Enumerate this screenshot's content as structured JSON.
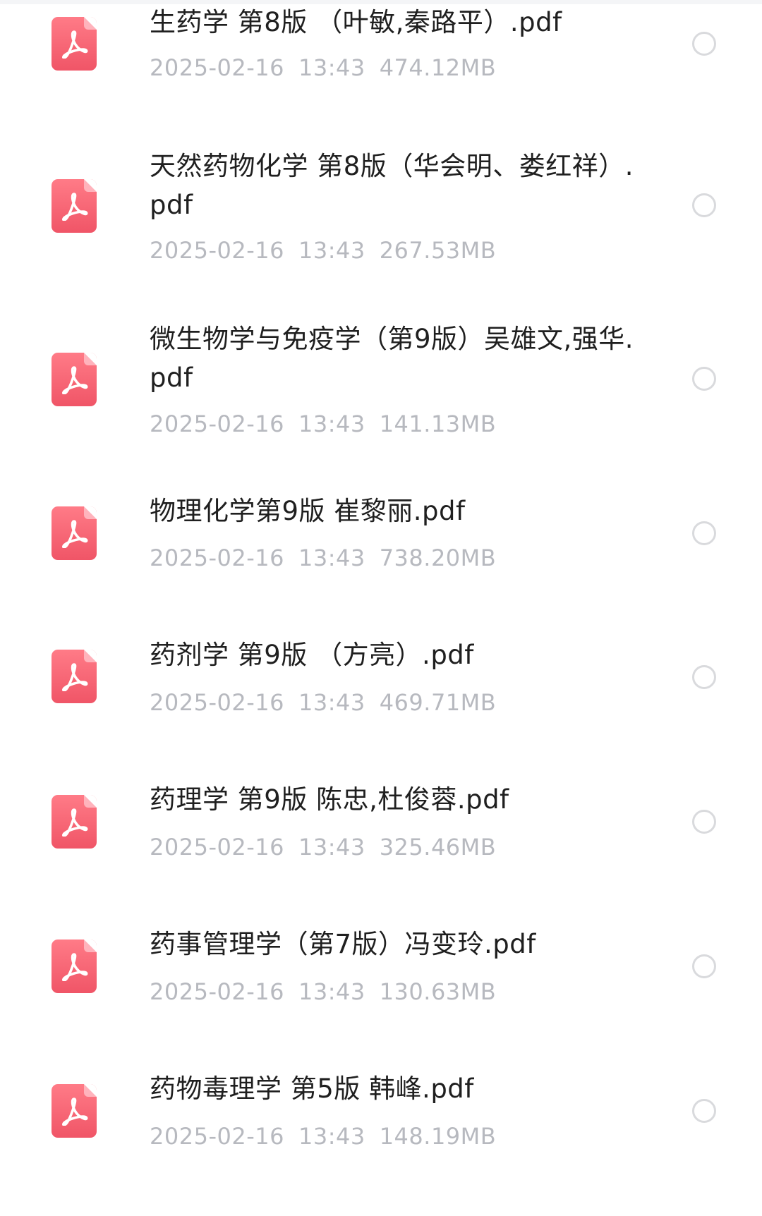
{
  "files": [
    {
      "name": "生药学 第8版 （叶敏,秦路平）.pdf",
      "date": "2025-02-16",
      "time": "13:43",
      "size": "474.12MB",
      "icon": "pdf-file-icon",
      "selected": false
    },
    {
      "name": "天然药物化学 第8版（华会明、娄红祥）.pdf",
      "date": "2025-02-16",
      "time": "13:43",
      "size": "267.53MB",
      "icon": "pdf-file-icon",
      "selected": false
    },
    {
      "name": "微生物学与免疫学（第9版）吴雄文,强华.pdf",
      "date": "2025-02-16",
      "time": "13:43",
      "size": "141.13MB",
      "icon": "pdf-file-icon",
      "selected": false
    },
    {
      "name": "物理化学第9版 崔黎丽.pdf",
      "date": "2025-02-16",
      "time": "13:43",
      "size": "738.20MB",
      "icon": "pdf-file-icon",
      "selected": false
    },
    {
      "name": "药剂学 第9版 （方亮）.pdf",
      "date": "2025-02-16",
      "time": "13:43",
      "size": "469.71MB",
      "icon": "pdf-file-icon",
      "selected": false
    },
    {
      "name": "药理学 第9版 陈忠,杜俊蓉.pdf",
      "date": "2025-02-16",
      "time": "13:43",
      "size": "325.46MB",
      "icon": "pdf-file-icon",
      "selected": false
    },
    {
      "name": "药事管理学（第7版）冯变玲.pdf",
      "date": "2025-02-16",
      "time": "13:43",
      "size": "130.63MB",
      "icon": "pdf-file-icon",
      "selected": false
    },
    {
      "name": "药物毒理学 第5版 韩峰.pdf",
      "date": "2025-02-16",
      "time": "13:43",
      "size": "148.19MB",
      "icon": "pdf-file-icon",
      "selected": false
    }
  ],
  "colors": {
    "icon_primary": "#f05567",
    "text_primary": "#1f1f1f",
    "text_secondary": "#b7b9bf",
    "radio_border": "#d9dadd"
  }
}
